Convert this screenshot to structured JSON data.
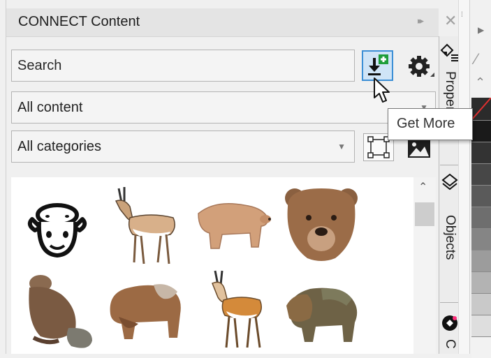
{
  "panel": {
    "title": "CONNECT Content",
    "expand_glyph": "▸▸",
    "close_glyph": "✕"
  },
  "search": {
    "placeholder": "Search",
    "value": ""
  },
  "toolbar": {
    "get_more_icon": "download-plus-icon",
    "settings_icon": "gear-icon",
    "vector_icon": "vector-filter-icon",
    "bitmap_icon": "bitmap-filter-icon"
  },
  "content_filter": {
    "selected": "All content"
  },
  "category_filter": {
    "selected": "All categories"
  },
  "tooltip": {
    "text": "Get More"
  },
  "tabs": [
    {
      "label": "Properties",
      "icon": "properties-icon"
    },
    {
      "label": "Objects",
      "icon": "layers-icon"
    },
    {
      "label": "C",
      "icon": "connect-icon"
    }
  ],
  "results": [
    {
      "icon": "sheep-icon"
    },
    {
      "icon": "pronghorn-icon"
    },
    {
      "icon": "walking-bear-icon"
    },
    {
      "icon": "bear-head-icon"
    },
    {
      "icon": "beaver-icon"
    },
    {
      "icon": "bison-brown-icon"
    },
    {
      "icon": "antelope-icon"
    },
    {
      "icon": "bison-dark-icon"
    }
  ],
  "colors": {
    "accent_button": "#cfe4f7",
    "accent_border": "#3c8fd6",
    "plus_badge": "#1e9e3a"
  }
}
